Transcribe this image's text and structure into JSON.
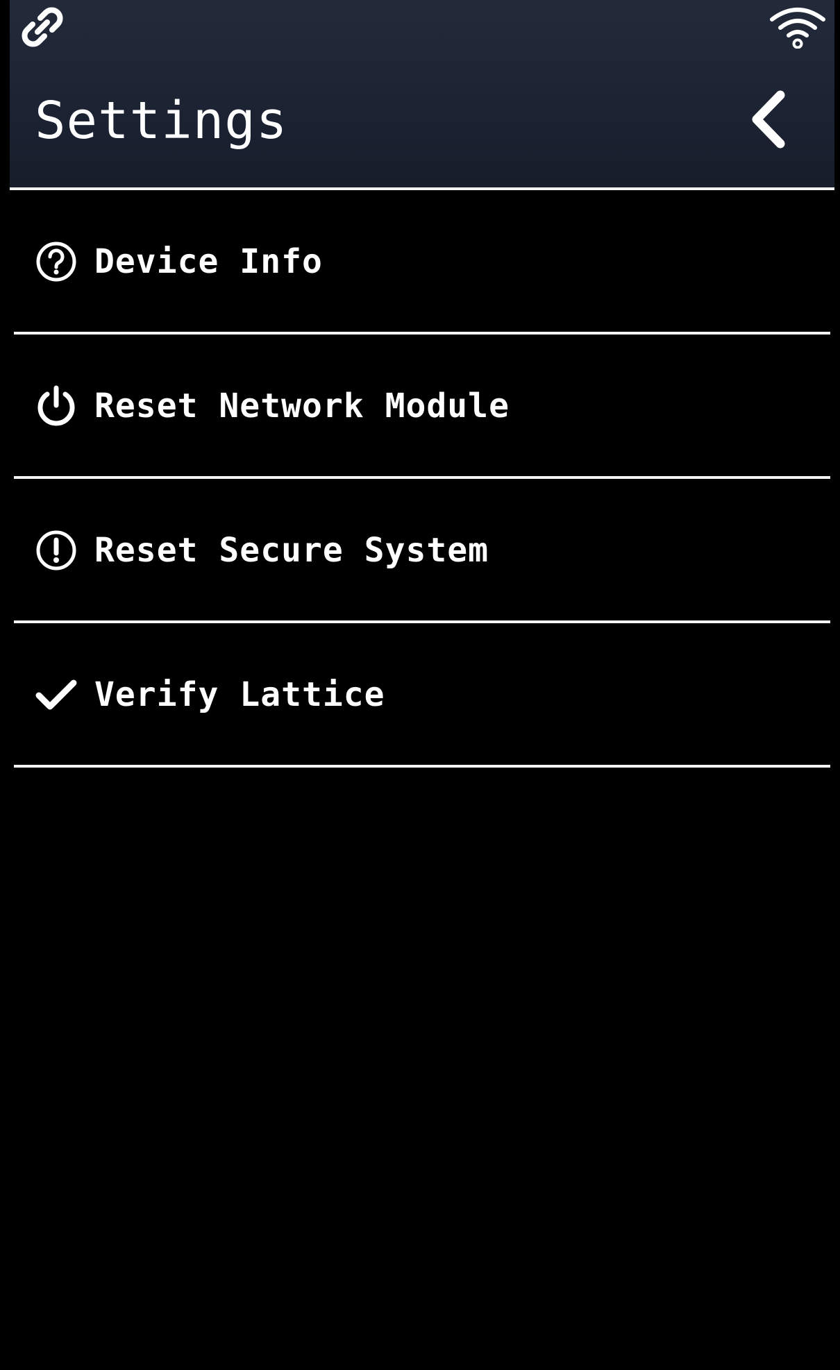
{
  "status_bar": {
    "left_icon": "link-icon",
    "right_icon": "wifi-icon"
  },
  "header": {
    "title": "Settings",
    "back_icon": "chevron-left-icon"
  },
  "menu": {
    "items": [
      {
        "label": "Device Info",
        "icon": "question-circle-icon"
      },
      {
        "label": "Reset Network Module",
        "icon": "power-icon"
      },
      {
        "label": "Reset Secure System",
        "icon": "exclamation-circle-icon"
      },
      {
        "label": "Verify Lattice",
        "icon": "checkmark-icon"
      }
    ]
  },
  "colors": {
    "header_background": "#1c2333",
    "background": "#000000",
    "text": "#ffffff",
    "divider": "#f2f2f2"
  }
}
